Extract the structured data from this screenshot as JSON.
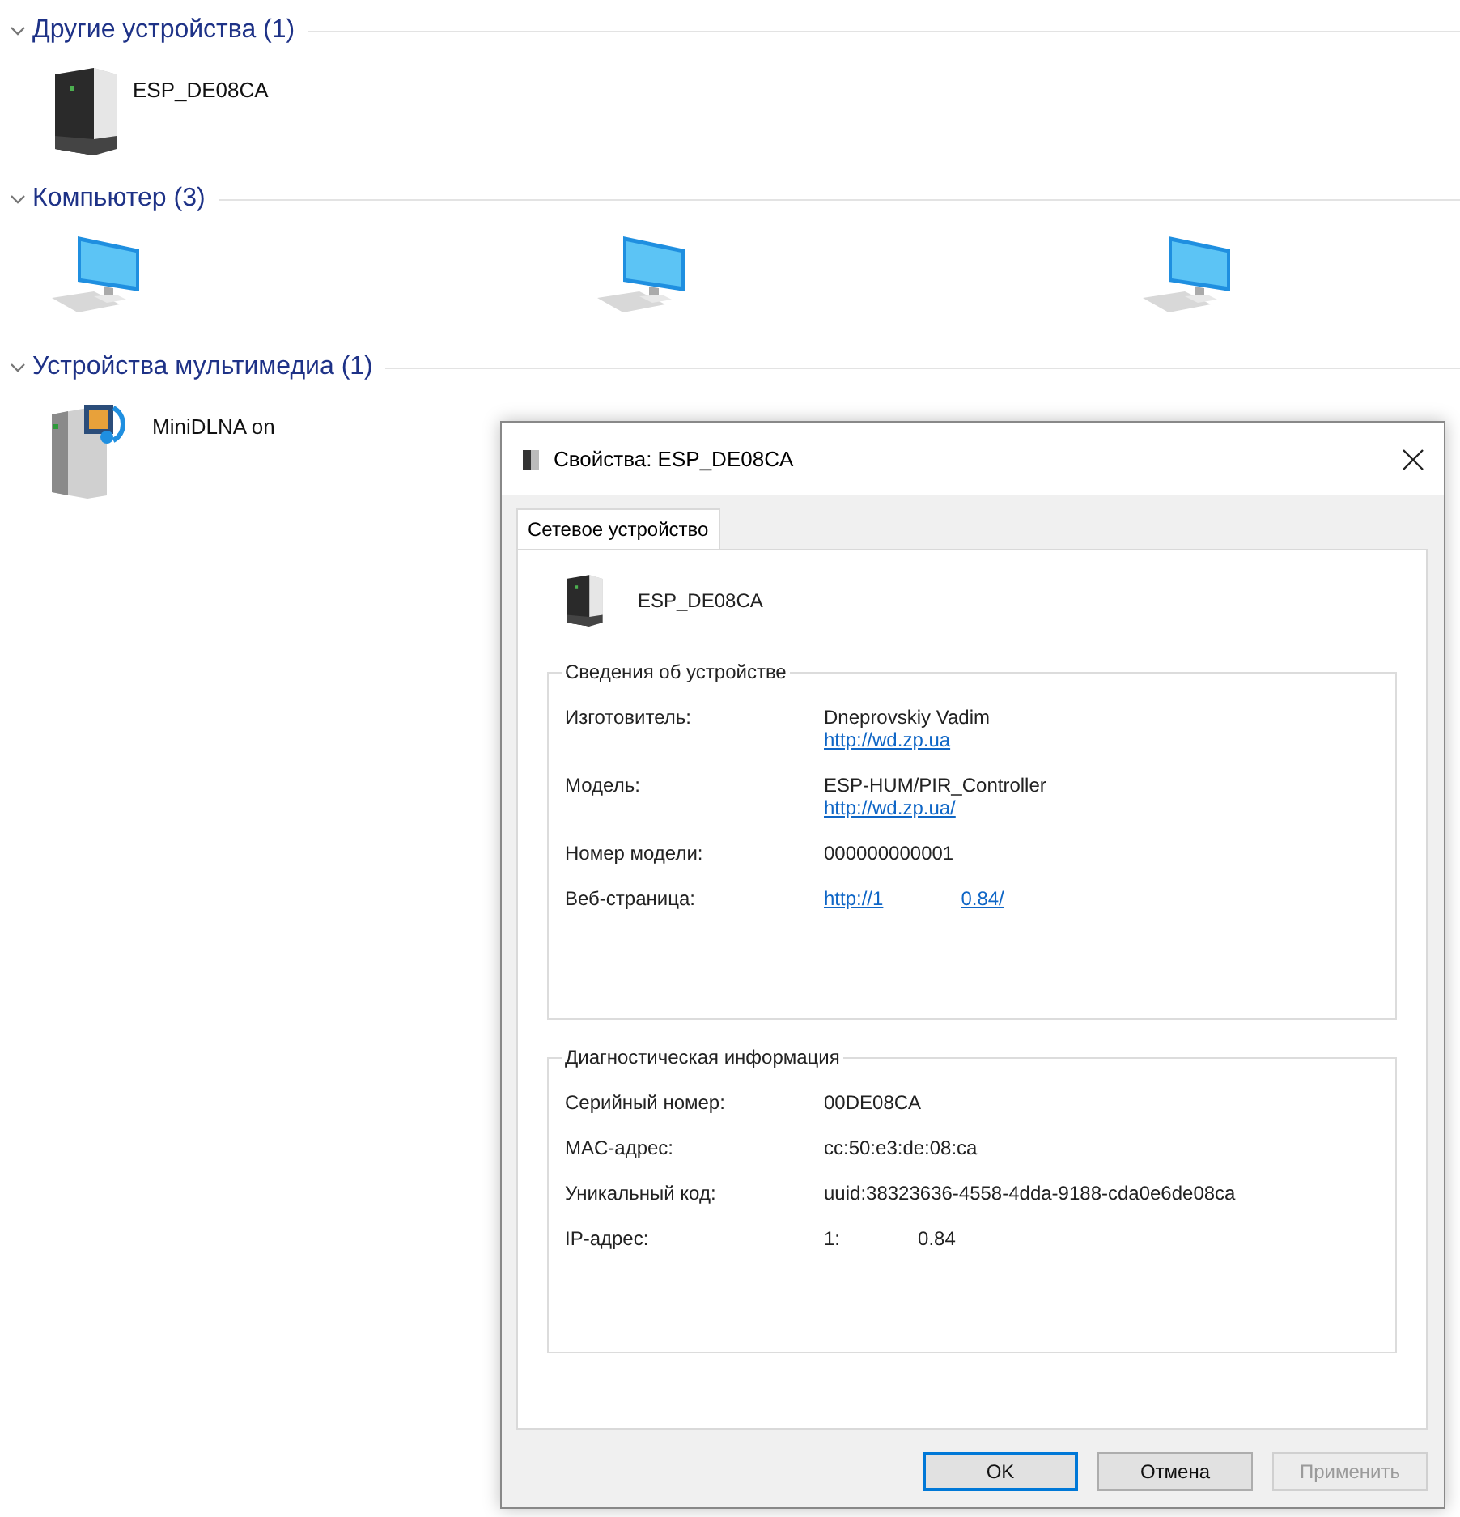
{
  "groups": [
    {
      "title": "Другие устройства (1)",
      "expanded": true,
      "items": [
        {
          "kind": "device",
          "label": "ESP_DE08CA"
        }
      ]
    },
    {
      "title": "Компьютер (3)",
      "expanded": true,
      "items": [
        {
          "kind": "computer"
        },
        {
          "kind": "computer"
        },
        {
          "kind": "computer"
        }
      ]
    },
    {
      "title": "Устройства мультимедиа (1)",
      "expanded": true,
      "items": [
        {
          "kind": "media",
          "label": "MiniDLNA on"
        }
      ]
    }
  ],
  "dialog": {
    "title": "Свойства: ESP_DE08CA",
    "tabs": [
      {
        "label": "Сетевое устройство",
        "selected": true
      }
    ],
    "device_name": "ESP_DE08CA",
    "sections": [
      {
        "title": "Сведения об устройстве",
        "rows": [
          {
            "label": "Изготовитель:",
            "lines": [
              [
                {
                  "text": "Dneprovskiy Vadim",
                  "kind": "text"
                }
              ],
              [
                {
                  "text": "http://wd.zp.ua",
                  "kind": "link"
                }
              ]
            ]
          },
          {
            "label": "Модель:",
            "lines": [
              [
                {
                  "text": "ESP-HUM/PIR_Controller",
                  "kind": "text"
                }
              ],
              [
                {
                  "text": "http://wd.zp.ua/",
                  "kind": "link"
                }
              ]
            ]
          },
          {
            "label": "Номер модели:",
            "lines": [
              [
                {
                  "text": "000000000001",
                  "kind": "text"
                }
              ]
            ]
          },
          {
            "label": "Веб-страница:",
            "lines": [
              [
                {
                  "text": "http://1",
                  "kind": "link"
                },
                {
                  "text": "0.84/",
                  "kind": "link"
                }
              ]
            ]
          }
        ]
      },
      {
        "title": "Диагностическая информация",
        "rows": [
          {
            "label": "Серийный номер:",
            "lines": [
              [
                {
                  "text": "00DE08CA",
                  "kind": "text"
                }
              ]
            ]
          },
          {
            "label": "MAC-адрес:",
            "lines": [
              [
                {
                  "text": "cc:50:e3:de:08:ca",
                  "kind": "text"
                }
              ]
            ]
          },
          {
            "label": "Уникальный код:",
            "lines": [
              [
                {
                  "text": "uuid:38323636-4558-4dda-9188-cda0e6de08ca",
                  "kind": "text"
                }
              ]
            ]
          },
          {
            "label": "IP-адрес:",
            "lines": [
              [
                {
                  "text": "1:",
                  "kind": "text"
                },
                {
                  "text": "0.84",
                  "kind": "text"
                }
              ]
            ]
          }
        ]
      }
    ],
    "buttons": [
      {
        "label": "OK",
        "default": true,
        "disabled": false
      },
      {
        "label": "Отмена",
        "default": false,
        "disabled": false
      },
      {
        "label": "Применить",
        "default": false,
        "disabled": true
      }
    ]
  }
}
